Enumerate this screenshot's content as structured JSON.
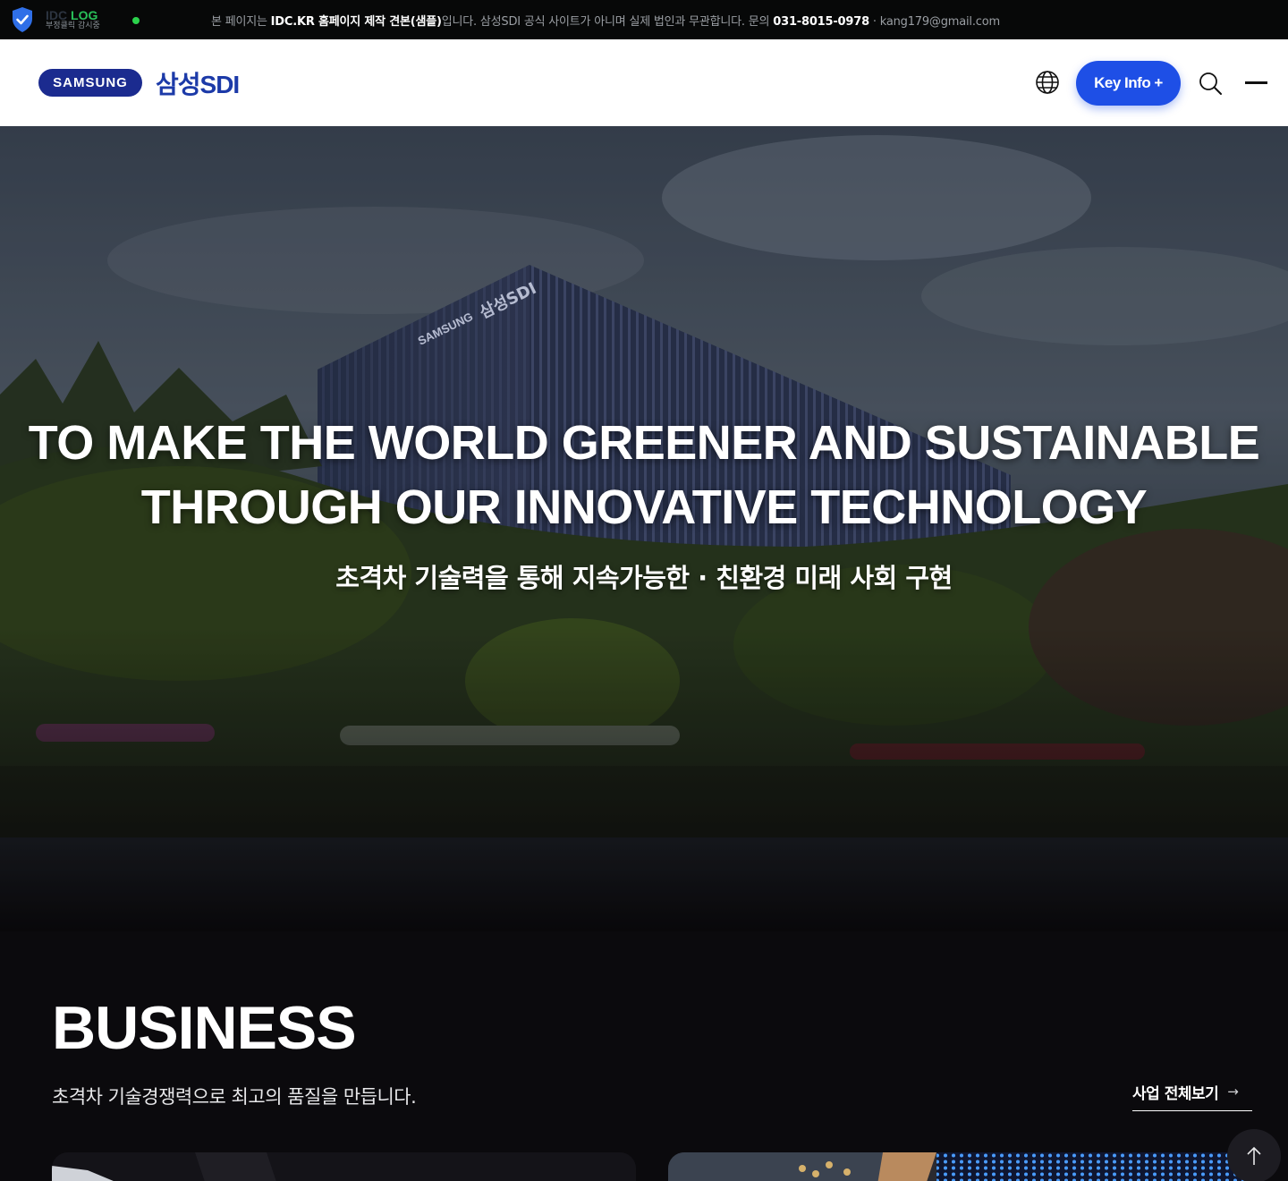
{
  "notice_bar": {
    "badge_brand_gray": "IDC",
    "badge_brand_green": "LOG",
    "badge_sub": "부정클릭 감시중",
    "text_1": "본 페이지는 ",
    "text_bold_1": "IDC.KR 홈페이지 제작 견본(샘플)",
    "text_2": "입니다. 삼성SDI 공식 사이트가 아니며 실제 법인과 무관합니다. 문의 ",
    "text_bold_2": "031-8015-0978",
    "text_3": " · kang179@gmail.com"
  },
  "header": {
    "logo_pill": "SAMSUNG",
    "logo_text": "삼성SDI",
    "key_info_label": "Key Info +",
    "icons": [
      "globe-icon",
      "search-icon",
      "menu-icon"
    ]
  },
  "hero": {
    "title_line_1": "TO MAKE THE WORLD GREENER AND SUSTAINABLE",
    "title_line_2": "THROUGH OUR INNOVATIVE TECHNOLOGY",
    "subtitle": "초격차 기술력을 통해 지속가능한 · 친환경 미래 사회 구현",
    "building_sign_1": "SAMSUNG",
    "building_sign_2": "삼성SDI"
  },
  "business": {
    "title": "BUSINESS",
    "description": "초격차 기술경쟁력으로 최고의 품질을 만듭니다.",
    "view_all_label": "사업 전체보기",
    "view_all_arrow": "→"
  },
  "colors": {
    "brand_blue": "#1b2b8f",
    "accent_blue": "#1e4fe6",
    "dark_bg": "#0b0a0d"
  }
}
